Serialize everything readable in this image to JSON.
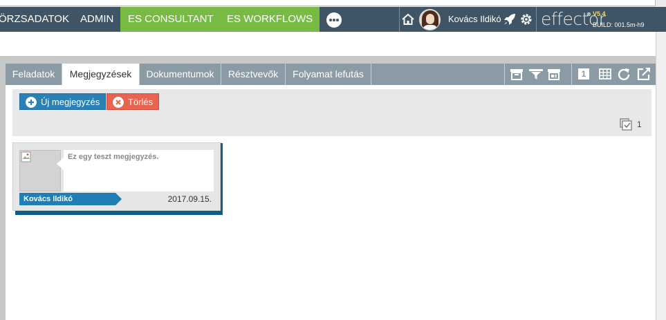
{
  "nav": {
    "items": [
      {
        "label": "ÖRZSADATOK"
      },
      {
        "label": "ADMIN"
      },
      {
        "label": "ES CONSULTANT"
      },
      {
        "label": "ES WORKFLOWS"
      }
    ],
    "user": {
      "name": "Kovács Ildikó"
    },
    "logo": {
      "text": "effector",
      "mark": "⊗",
      "version": "V5.4",
      "build": "BUILD: 001.5m-h9"
    },
    "icons": [
      "more-icon",
      "home-icon",
      "rocket-icon",
      "gear-icon"
    ]
  },
  "tabs": [
    {
      "label": "Feladatok",
      "active": false
    },
    {
      "label": "Megjegyzések",
      "active": true
    },
    {
      "label": "Dokumentumok",
      "active": false
    },
    {
      "label": "Résztvevők",
      "active": false
    },
    {
      "label": "Folyamat lefutás",
      "active": false
    }
  ],
  "toolbar": {
    "icons": [
      "archive-icon",
      "filter-icon",
      "card-view-icon",
      "single-view-icon",
      "grid-view-icon",
      "refresh-icon",
      "external-link-icon"
    ],
    "single_view_label": "1"
  },
  "actions": {
    "new_label": "Új megjegyzés",
    "delete_label": "Törlés",
    "count": "1"
  },
  "notes": [
    {
      "text": "Ez egy teszt megjegyzés.",
      "author": "Kovács Ildikó",
      "date": "2017.09.15."
    }
  ],
  "colors": {
    "nav_bg": "#3f5566",
    "nav_green": "#77bb44",
    "tab_bar": "#8b9ba5",
    "primary_button": "#2a81b6",
    "danger_button": "#e86450",
    "author_tag": "#1f7fb5"
  }
}
